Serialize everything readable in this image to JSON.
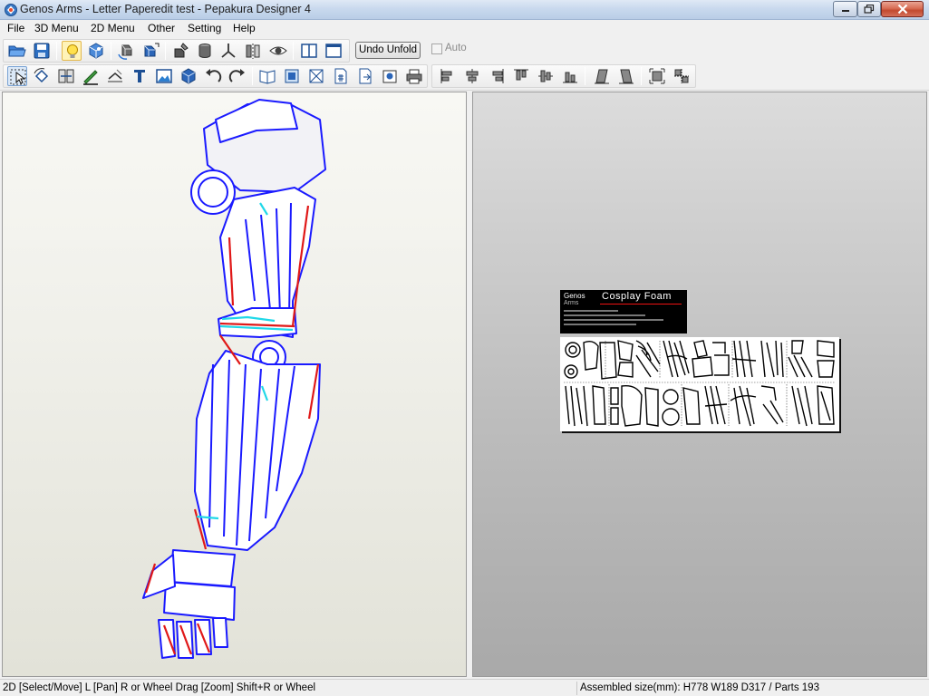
{
  "window": {
    "title": "Genos Arms - Letter Paperedit test - Pepakura Designer 4"
  },
  "menu": {
    "items": [
      "File",
      "3D Menu",
      "2D Menu",
      "Other",
      "Setting",
      "Help"
    ]
  },
  "toolbar": {
    "undo_unfold_label": "Undo Unfold",
    "auto_label": "Auto",
    "auto_checked": false
  },
  "icons": {
    "toolbar1": [
      "open-folder-icon",
      "save-icon",
      "light-bulb-icon",
      "cube-texture-icon",
      "rotate-model-icon",
      "cube-move-icon",
      "cylinder-icon",
      "axis-icon",
      "flip-icon",
      "eye-icon",
      "split-view-icon",
      "single-view-icon"
    ],
    "toolbar2": [
      "select-move-icon",
      "rotate-icon",
      "join-edge-icon",
      "draw-line-icon",
      "fold-line-icon",
      "text-tool-icon",
      "image-icon",
      "cube-icon",
      "undo-icon",
      "redo-icon",
      "book-icon",
      "arrange-icon",
      "flap-icon",
      "page-number-icon",
      "export-icon",
      "print-preview-icon",
      "print-icon",
      "align-left-icon",
      "align-center-h-icon",
      "align-right-icon",
      "align-top-icon",
      "align-center-v-icon",
      "align-bottom-icon",
      "skew-left-icon",
      "skew-right-icon",
      "fit-page-icon",
      "distribute-icon"
    ]
  },
  "pattern_sheet": {
    "brand_line1": "Genos",
    "brand_line2": "Arms",
    "title": "Cosplay Foam"
  },
  "statusbar": {
    "left": "2D [Select/Move] L [Pan] R or Wheel Drag [Zoom] Shift+R or Wheel",
    "right": "Assembled size(mm): H778  W189  D317 / Parts 193"
  },
  "colors": {
    "model_outline": "#1a1aff",
    "model_fill": "#ffffff",
    "mountain_fold": "#e01818",
    "valley_fold": "#20d8e8",
    "view3d_bg": "#f4f4ee",
    "view2d_bg": "#bdbdbd"
  }
}
